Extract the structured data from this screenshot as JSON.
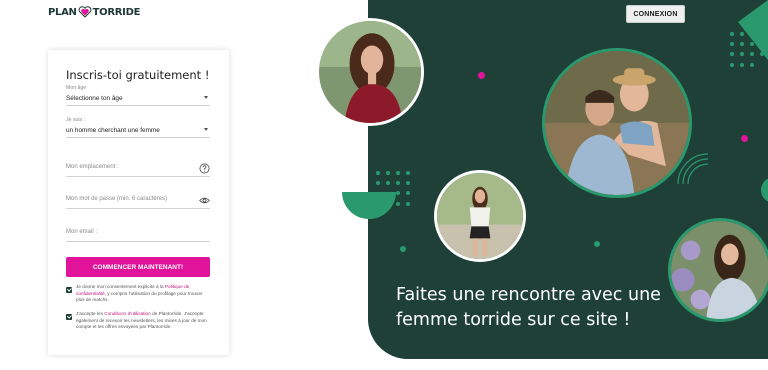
{
  "logo": {
    "part1": "PLAN",
    "part2": "TORRIDE"
  },
  "header": {
    "login_label": "CONNEXION"
  },
  "form": {
    "title": "Inscris-toi gratuitement !",
    "age": {
      "label": "Mon âge",
      "value": "Sélectionne ton âge"
    },
    "gender": {
      "label": "Je suis :",
      "value": "un homme cherchant une femme"
    },
    "location": {
      "placeholder": "Mon emplacement :"
    },
    "password": {
      "placeholder": "Mon mot de passe (min. 6 caractères)"
    },
    "email": {
      "placeholder": "Mon email :"
    },
    "submit_label": "COMMENCER MAINTENANT!",
    "consent1": {
      "before": "Je donne mon consentement explicite à la",
      "link": "Politique de confidentialité",
      "after": ", y compris l'utilisation du profilage pour trouver plus de matchs."
    },
    "consent2": {
      "before": "J'accepte les",
      "link": "Conditions d'utilisation",
      "after": "de Plantorride. J'accepte également de recevoir les newsletters, les mises à jour de mon compte et les offres envoyées par Plantorride."
    }
  },
  "hero": {
    "tagline": "Faites une rencontre avec une femme torride sur ce site !"
  },
  "colors": {
    "brand_green": "#1e4037",
    "accent_pink": "#e0139a",
    "accent_green": "#2a9a6e"
  }
}
